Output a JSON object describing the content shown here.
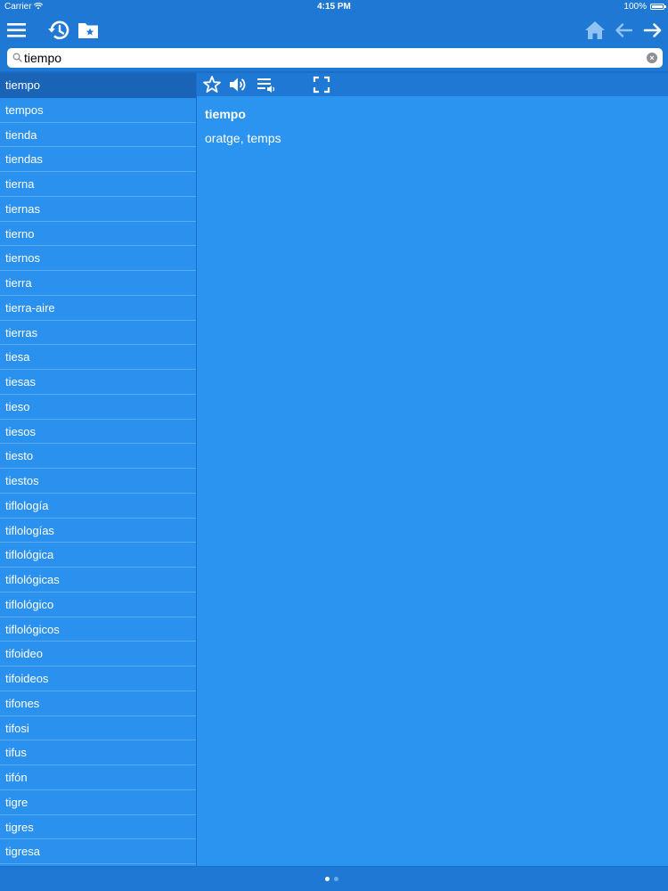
{
  "status_bar": {
    "carrier": "Carrier",
    "time": "4:15 PM",
    "battery": "100%"
  },
  "toolbar": {
    "icons": [
      "menu-icon",
      "history-icon",
      "favorites-folder-icon",
      "home-icon",
      "back-arrow-icon",
      "forward-arrow-icon"
    ]
  },
  "search": {
    "value": "tiempo",
    "placeholder": ""
  },
  "word_list": {
    "selected_index": 0,
    "items": [
      "tiempo",
      "tempos",
      "tienda",
      "tiendas",
      "tierna",
      "tiernas",
      "tierno",
      "tiernos",
      "tierra",
      "tierra-aire",
      "tierras",
      "tiesa",
      "tiesas",
      "tieso",
      "tiesos",
      "tiesto",
      "tiestos",
      "tiflología",
      "tiflologías",
      "tiflológica",
      "tiflológicas",
      "tiflológico",
      "tiflológicos",
      "tifoideo",
      "tifoideos",
      "tifones",
      "tifosi",
      "tifus",
      "tifón",
      "tigre",
      "tigres",
      "tigresa"
    ]
  },
  "detail_toolbar": {
    "icons": [
      "star-icon",
      "speaker-icon",
      "playlist-audio-icon",
      "fullscreen-icon"
    ]
  },
  "entry": {
    "headword": "tiempo",
    "translation": "oratge, temps"
  },
  "pager": {
    "pages": 2,
    "current": 1
  },
  "colors": {
    "bar": "#1f78d4",
    "list_bg": "#2b91ee",
    "selected_row": "#1a64b8",
    "detail_bg": "#2b93f0"
  }
}
